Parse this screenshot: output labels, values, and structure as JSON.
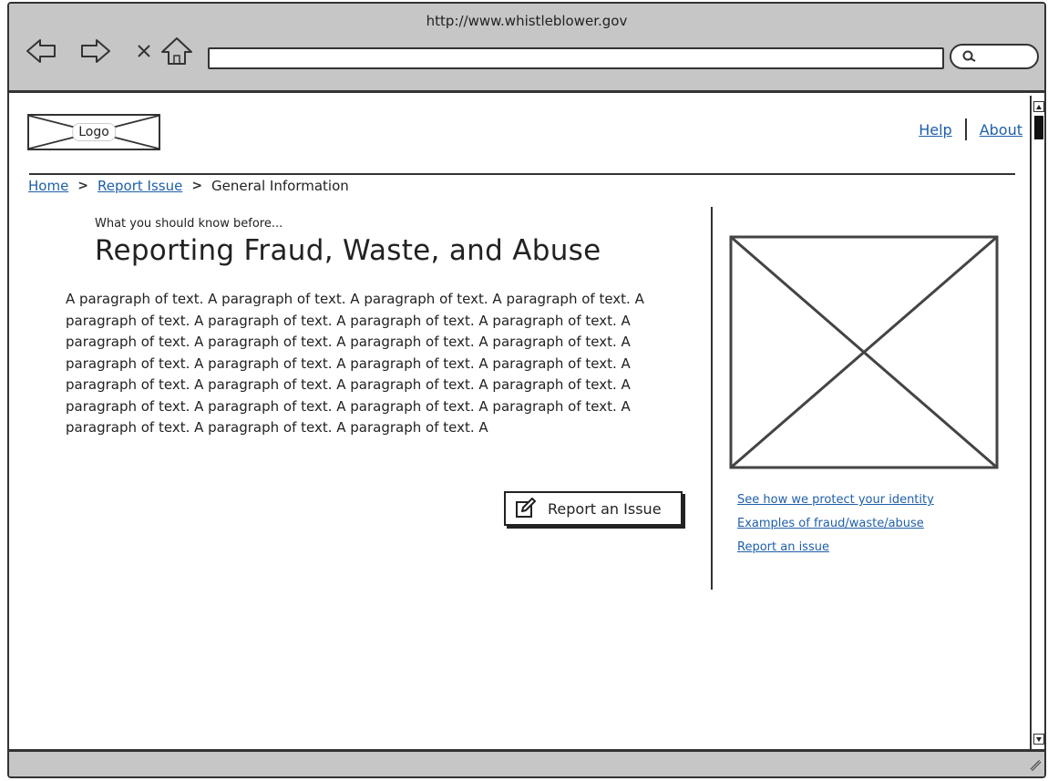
{
  "browser": {
    "url": "http://www.whistleblower.gov",
    "nav_icons": [
      "back-arrow-icon",
      "forward-arrow-icon",
      "close-icon",
      "home-icon",
      "search-icon"
    ]
  },
  "header": {
    "logo_label": "Logo",
    "links": [
      "Help",
      "About"
    ]
  },
  "breadcrumb": [
    "Home",
    "Report Issue",
    "General Information"
  ],
  "main": {
    "kicker": "What you should know before...",
    "title": "Reporting Fraud, Waste, and Abuse",
    "paragraph": "A paragraph of text. A paragraph of text. A paragraph of text. A paragraph of text. A paragraph of text. A paragraph of text. A paragraph of text. A paragraph of text. A paragraph of text. A paragraph of text. A paragraph of text. A paragraph of text. A paragraph of text. A paragraph of text. A paragraph of text. A paragraph of text. A paragraph of text. A paragraph of text. A paragraph of text. A paragraph of text. A paragraph of text. A paragraph of text. A paragraph of text. A paragraph of text. A paragraph of text. A paragraph of text. A paragraph of text. A",
    "report_button": "Report an Issue"
  },
  "sidebar": {
    "links": [
      "See how we protect your identity",
      "Examples of fraud/waste/abuse",
      "Report an issue"
    ]
  }
}
